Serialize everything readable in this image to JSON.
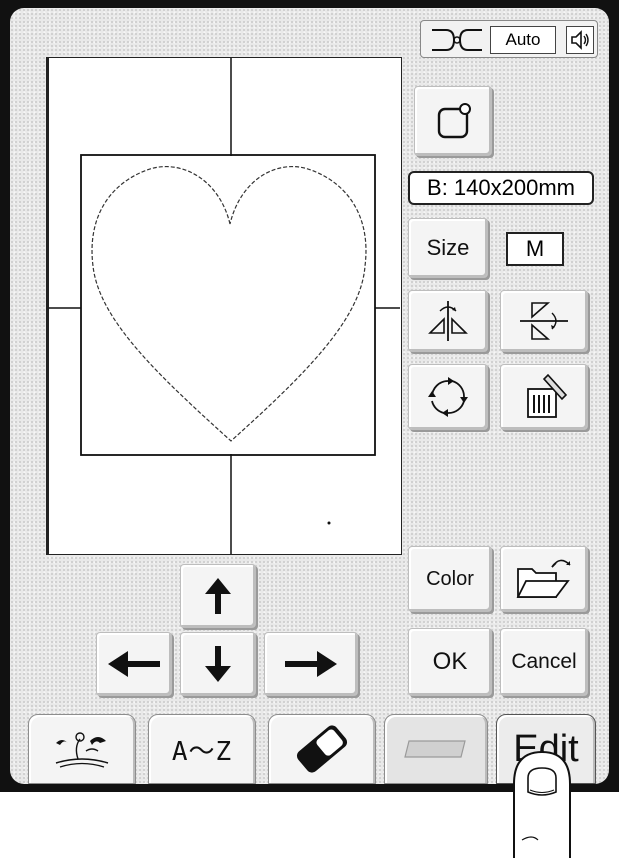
{
  "top_bar": {
    "thread_mode": "Auto",
    "icons": [
      "thread-cut-icon",
      "speaker-icon"
    ]
  },
  "design_area": {
    "shape_icon": "heart-icon"
  },
  "hoop": {
    "label": "B: 140x200mm"
  },
  "size": {
    "button_label": "Size",
    "current": "M"
  },
  "tools": {
    "icons": [
      "hoop-select-icon",
      "mirror-horizontal-icon",
      "mirror-vertical-icon",
      "rotate-icon",
      "delete-icon",
      "open-folder-icon"
    ]
  },
  "actions": {
    "color_label": "Color",
    "ok_label": "OK",
    "cancel_label": "Cancel"
  },
  "arrows": [
    "arrow-up-icon",
    "arrow-left-icon",
    "arrow-down-icon",
    "arrow-right-icon"
  ],
  "tabs": {
    "pattern_icon": "birds-flower-icon",
    "alphabet_label": "A～Z",
    "eraser_icon": "eraser-icon",
    "card_icon": "card-icon",
    "edit_label": "Edit"
  },
  "colors": {
    "screen_bg": "#e9e9e9",
    "frame": "#111111",
    "button_face": "#f4f4f4"
  }
}
